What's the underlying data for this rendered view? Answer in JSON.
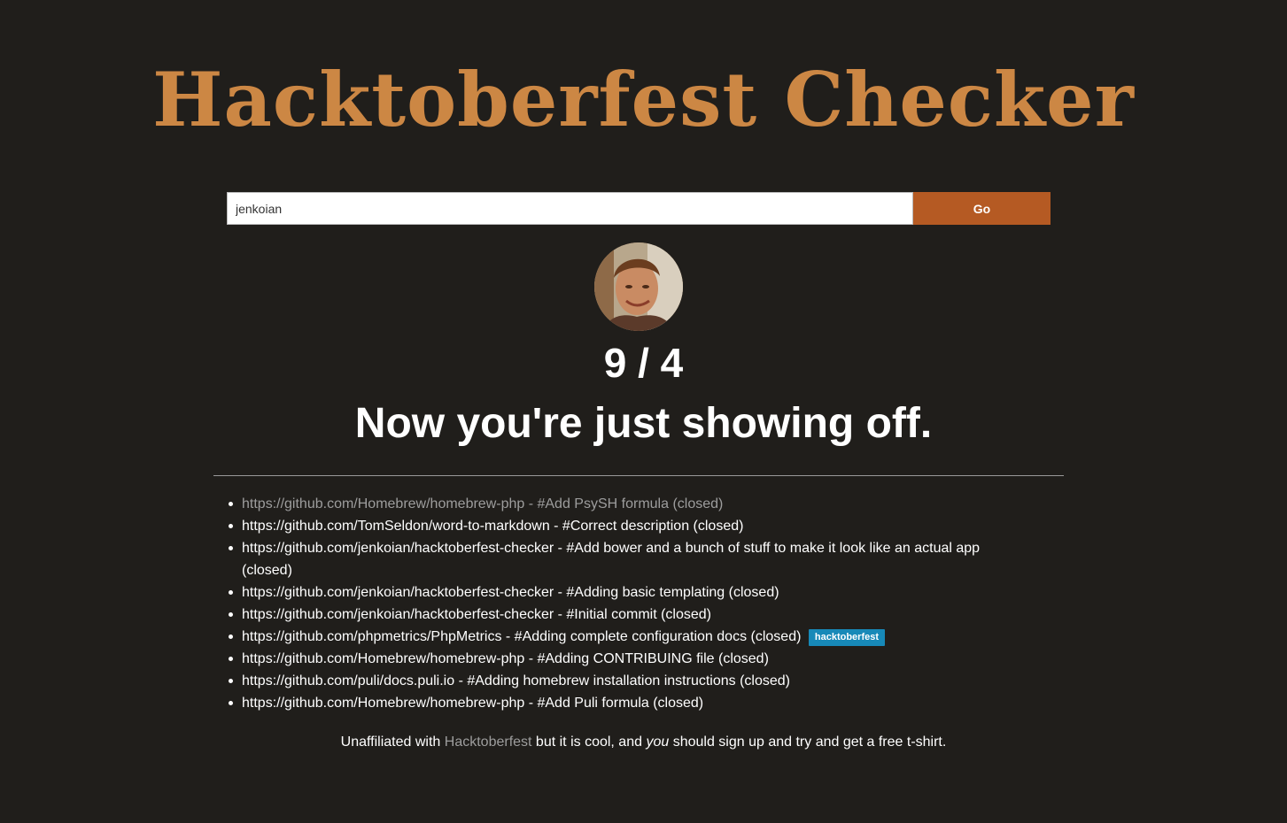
{
  "header": {
    "title": "Hacktoberfest Checker"
  },
  "search": {
    "value": "jenkoian",
    "button_label": "Go"
  },
  "result": {
    "score": "9 / 4",
    "message": "Now you're just showing off."
  },
  "pull_requests": [
    {
      "text": "https://github.com/Homebrew/homebrew-php - #Add PsySH formula (closed)",
      "dimmed": true
    },
    {
      "text": "https://github.com/TomSeldon/word-to-markdown - #Correct description (closed)"
    },
    {
      "text": "https://github.com/jenkoian/hacktoberfest-checker - #Add bower and a bunch of stuff to make it look like an actual app (closed)"
    },
    {
      "text": "https://github.com/jenkoian/hacktoberfest-checker - #Adding basic templating (closed)"
    },
    {
      "text": "https://github.com/jenkoian/hacktoberfest-checker - #Initial commit (closed)"
    },
    {
      "text": "https://github.com/phpmetrics/PhpMetrics - #Adding complete configuration docs (closed)",
      "badge": "hacktoberfest"
    },
    {
      "text": "https://github.com/Homebrew/homebrew-php - #Adding CONTRIBUING file (closed)"
    },
    {
      "text": "https://github.com/puli/docs.puli.io - #Adding homebrew installation instructions (closed)"
    },
    {
      "text": "https://github.com/Homebrew/homebrew-php - #Add Puli formula (closed)"
    }
  ],
  "footer": {
    "prefix": "Unaffiliated with ",
    "link": "Hacktoberfest",
    "middle": " but it is cool, and ",
    "emphasis": "you",
    "suffix": " should sign up and try and get a free t-shirt."
  },
  "colors": {
    "background": "#201e1b",
    "title": "#cc8744",
    "button": "#b55a23",
    "badge": "#1789b8",
    "link_dim": "#9d9d9d"
  },
  "icons": {
    "avatar": "user-avatar"
  }
}
